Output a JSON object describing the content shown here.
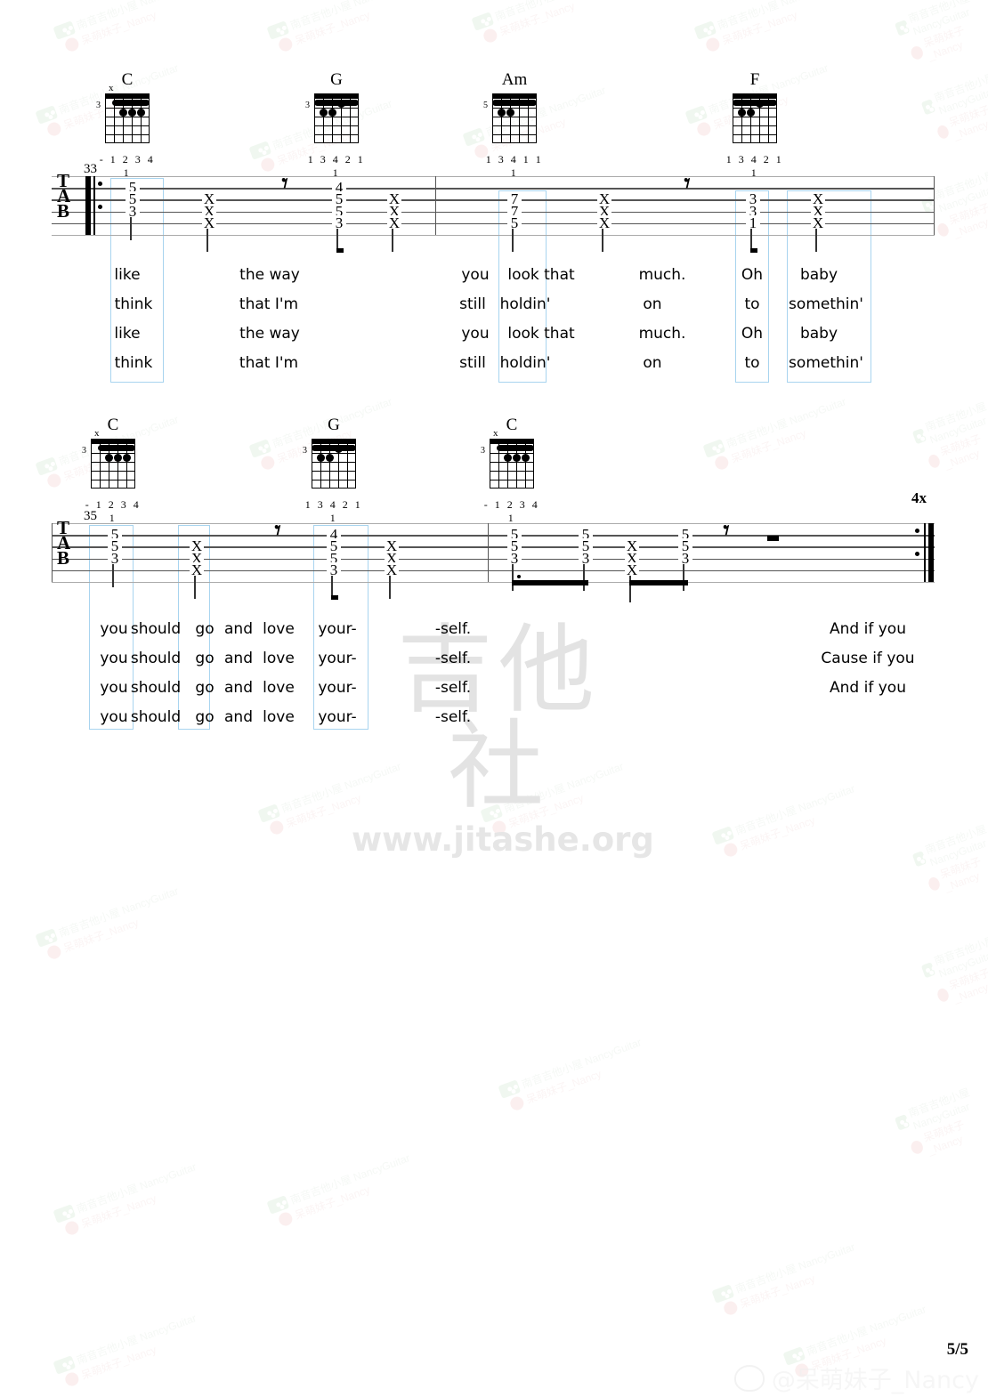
{
  "page": {
    "page_number": "5/5",
    "social_handle": "@呆萌妹子_Nancy",
    "center_watermark_cn": "吉他社",
    "center_watermark_url": "www.jitashe.org",
    "watermark_wechat": "南音吉他小屋 NancyGuitar",
    "watermark_weibo": "呆萌妹子_Nancy",
    "tab_label_lines": [
      "T",
      "A",
      "B"
    ]
  },
  "systems": [
    {
      "measure_number": "33",
      "repeat_times": "",
      "chords": [
        {
          "name": "C",
          "base_fret": "3",
          "fingers": "- 1 2 3 4 1",
          "mute_string": "x"
        },
        {
          "name": "G",
          "base_fret": "3",
          "fingers": "1 3 4 2 1 1",
          "mute_string": ""
        },
        {
          "name": "Am",
          "base_fret": "5",
          "fingers": "1 3 4 1 1 1",
          "mute_string": ""
        },
        {
          "name": "F",
          "base_fret": "",
          "fingers": "1 3 4 2 1 1",
          "mute_string": ""
        }
      ],
      "notes": [
        {
          "type": "chord",
          "frets": [
            "5",
            "5",
            "3"
          ]
        },
        {
          "type": "mute",
          "frets": [
            "X",
            "X",
            "X"
          ]
        },
        {
          "type": "rest8"
        },
        {
          "type": "chord",
          "frets": [
            "4",
            "5",
            "5",
            "3"
          ]
        },
        {
          "type": "mute",
          "frets": [
            "X",
            "X",
            "X"
          ]
        },
        {
          "type": "chord",
          "frets": [
            "7",
            "7",
            "5"
          ]
        },
        {
          "type": "mute",
          "frets": [
            "X",
            "X",
            "X"
          ]
        },
        {
          "type": "rest8"
        },
        {
          "type": "chord",
          "frets": [
            "3",
            "3",
            "1"
          ]
        },
        {
          "type": "mute",
          "frets": [
            "X",
            "X",
            "X"
          ]
        }
      ],
      "lyrics": [
        [
          "like",
          "the way",
          "you",
          "look that",
          "much.",
          "Oh",
          "baby"
        ],
        [
          "think",
          "that I'm",
          "still",
          "holdin'",
          "on",
          "to",
          "somethin'"
        ],
        [
          "like",
          "the way",
          "you",
          "look that",
          "much.",
          "Oh",
          "baby"
        ],
        [
          "think",
          "that I'm",
          "still",
          "holdin'",
          "on",
          "to",
          "somethin'"
        ]
      ]
    },
    {
      "measure_number": "35",
      "repeat_times": "4x",
      "chords": [
        {
          "name": "C",
          "base_fret": "3",
          "fingers": "- 1 2 3 4 1",
          "mute_string": "x"
        },
        {
          "name": "G",
          "base_fret": "3",
          "fingers": "1 3 4 2 1 1",
          "mute_string": ""
        },
        {
          "name": "C",
          "base_fret": "3",
          "fingers": "- 1 2 3 4 1",
          "mute_string": "x"
        }
      ],
      "notes": [
        {
          "type": "chord",
          "frets": [
            "5",
            "5",
            "3"
          ]
        },
        {
          "type": "mute",
          "frets": [
            "X",
            "X",
            "X"
          ]
        },
        {
          "type": "rest8"
        },
        {
          "type": "chord",
          "frets": [
            "4",
            "5",
            "5",
            "3"
          ]
        },
        {
          "type": "mute",
          "frets": [
            "X",
            "X",
            "X"
          ]
        },
        {
          "type": "chord",
          "frets": [
            "5",
            "5",
            "3"
          ]
        },
        {
          "type": "chord",
          "frets": [
            "5",
            "5",
            "3"
          ]
        },
        {
          "type": "mute",
          "frets": [
            "X",
            "X",
            "X"
          ]
        },
        {
          "type": "chord",
          "frets": [
            "5",
            "5",
            "3"
          ]
        },
        {
          "type": "rest8"
        },
        {
          "type": "rest-bar"
        }
      ],
      "lyrics": [
        [
          "you",
          "should",
          "go",
          "and",
          "love",
          "your-",
          "-self.",
          "And if you"
        ],
        [
          "you",
          "should",
          "go",
          "and",
          "love",
          "your-",
          "-self.",
          "Cause if you"
        ],
        [
          "you",
          "should",
          "go",
          "and",
          "love",
          "your-",
          "-self.",
          "And if you"
        ],
        [
          "you",
          "should",
          "go",
          "and",
          "love",
          "your-",
          "-self.",
          ""
        ]
      ]
    }
  ],
  "colors": {
    "highlight_box": "#a8d4ef",
    "staff_line": "#555555",
    "watermark": "#e3e3e3"
  }
}
